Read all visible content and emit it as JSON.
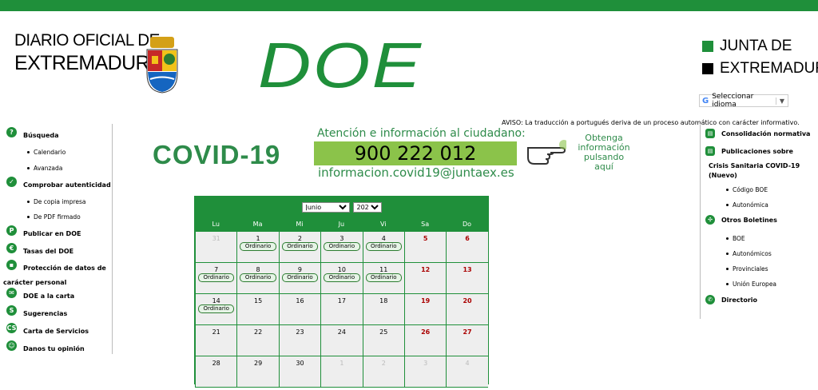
{
  "header": {
    "logo_line1": "DIARIO OFICIAL DE",
    "logo_line2": "EXTREMADURA",
    "brand": "DOE",
    "junta_line1": "JUNTA DE",
    "junta_line2": "EXTREMADURA",
    "translate_label": "Seleccionar idioma",
    "aviso": "AVISO: La traducción a portugués deriva de un proceso automático con carácter informativo."
  },
  "left_nav": {
    "busqueda": "Búsqueda",
    "calendario": "Calendario",
    "avanzada": "Avanzada",
    "comprobar": "Comprobar autenticidad",
    "copia": "De copia impresa",
    "pdf": "De PDF firmado",
    "publicar": "Publicar en DOE",
    "tasas": "Tasas del DOE",
    "proteccion1": "Protección de datos de",
    "proteccion2": "carácter personal",
    "carta": "DOE a la carta",
    "sugerencias": "Sugerencias",
    "servicios": "Carta de Servicios",
    "opinion": "Danos tu opinión"
  },
  "banner": {
    "covid": "COVID-19",
    "atencion": "Atención e información al ciudadano:",
    "phone": "900 222 012",
    "email": "informacion.covid19@juntaex.es",
    "obtenga": "Obtenga información pulsando aquí"
  },
  "calendar": {
    "month": "Junio",
    "year": "2021",
    "days": [
      "Lu",
      "Ma",
      "Mi",
      "Ju",
      "Vi",
      "Sa",
      "Do"
    ],
    "badge": "Ordinario"
  },
  "right_nav": {
    "consolidacion": "Consolidación normativa",
    "publicaciones": "Publicaciones sobre",
    "crisis1": "Crisis Sanitaria COVID-19",
    "crisis2": "(Nuevo)",
    "codigo": "Código BOE",
    "autonomica": "Autonómica",
    "otros": "Otros Boletines",
    "boe": "BOE",
    "autonomicos": "Autonómicos",
    "provinciales": "Provinciales",
    "union": "Unión Europea",
    "directorio": "Directorio"
  },
  "colors": {
    "brand_green": "#1f8f3a",
    "weekend_red": "#a00000"
  }
}
